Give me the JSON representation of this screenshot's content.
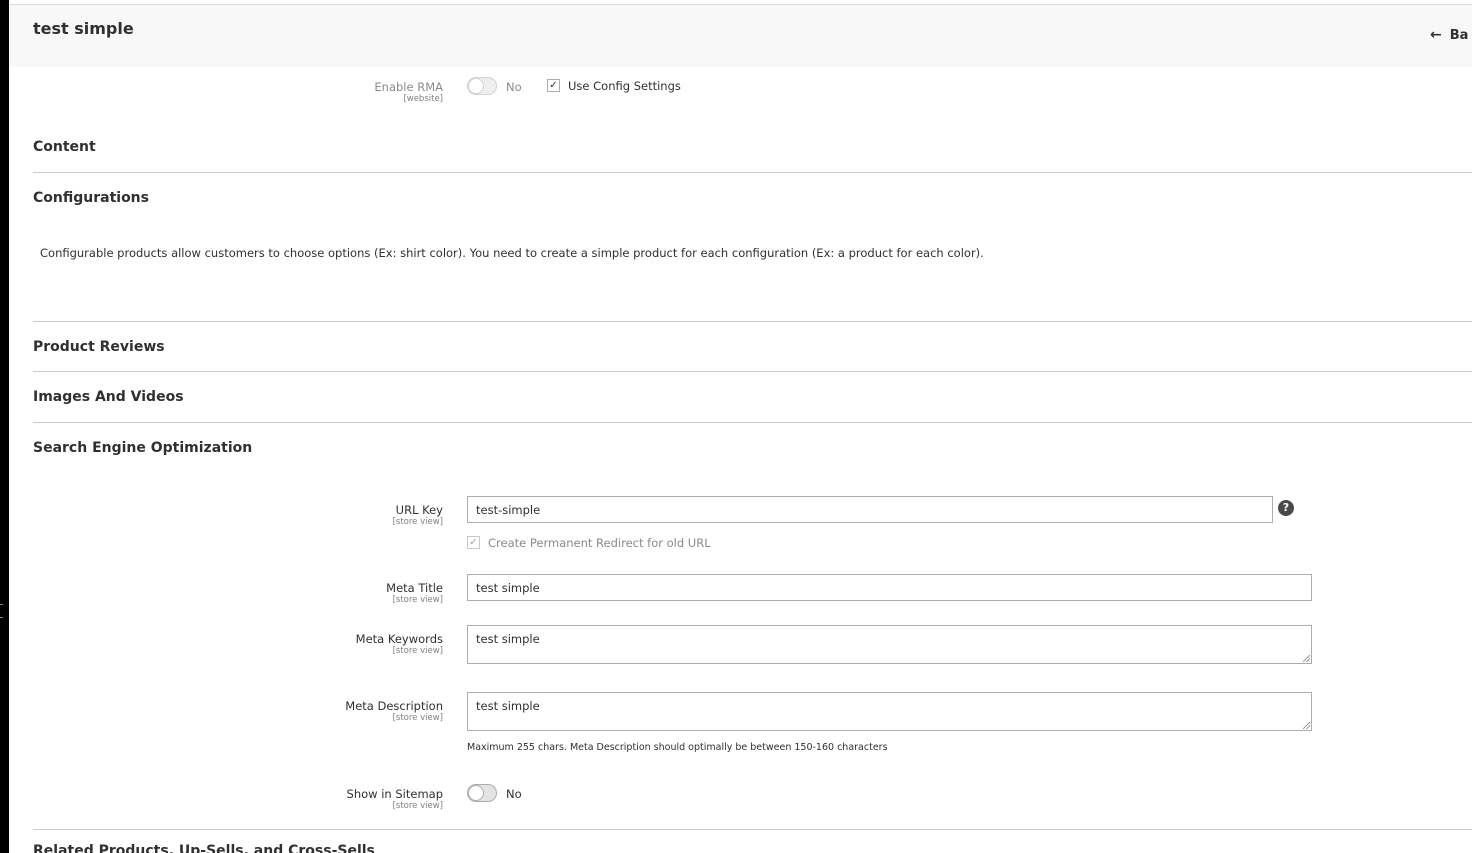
{
  "header": {
    "title": "test simple",
    "back_label": "Ba",
    "back_icon": "arrow-left-icon"
  },
  "rma": {
    "label": "Enable RMA",
    "scope": "[website]",
    "toggle_text": "No",
    "toggle_on": false,
    "use_config_label": "Use Config Settings",
    "use_config_checked": true
  },
  "sections": {
    "content": "Content",
    "configurations": "Configurations",
    "configurations_note": "Configurable products allow customers to choose options (Ex: shirt color). You need to create a simple product for each configuration (Ex: a product for each color).",
    "product_reviews": "Product Reviews",
    "images_videos": "Images And Videos",
    "seo": "Search Engine Optimization",
    "related": "Related Products, Up-Sells, and Cross-Sells"
  },
  "seo": {
    "url_key": {
      "label": "URL Key",
      "scope": "[store view]",
      "value": "test-simple",
      "help_icon": "question-circle-icon"
    },
    "redirect": {
      "label": "Create Permanent Redirect for old URL",
      "checked": true,
      "disabled": true
    },
    "meta_title": {
      "label": "Meta Title",
      "scope": "[store view]",
      "value": "test simple"
    },
    "meta_keywords": {
      "label": "Meta Keywords",
      "scope": "[store view]",
      "value": "test simple"
    },
    "meta_description": {
      "label": "Meta Description",
      "scope": "[store view]",
      "value": "test simple",
      "note": "Maximum 255 chars. Meta Description should optimally be between 150-160 characters"
    },
    "sitemap": {
      "label": "Show in Sitemap",
      "scope": "[store view]",
      "toggle_text": "No",
      "toggle_on": false
    }
  },
  "colors": {
    "header_bg": "#f8f8f8",
    "text": "#303030",
    "border": "#adadad",
    "divider": "#cccccc"
  }
}
